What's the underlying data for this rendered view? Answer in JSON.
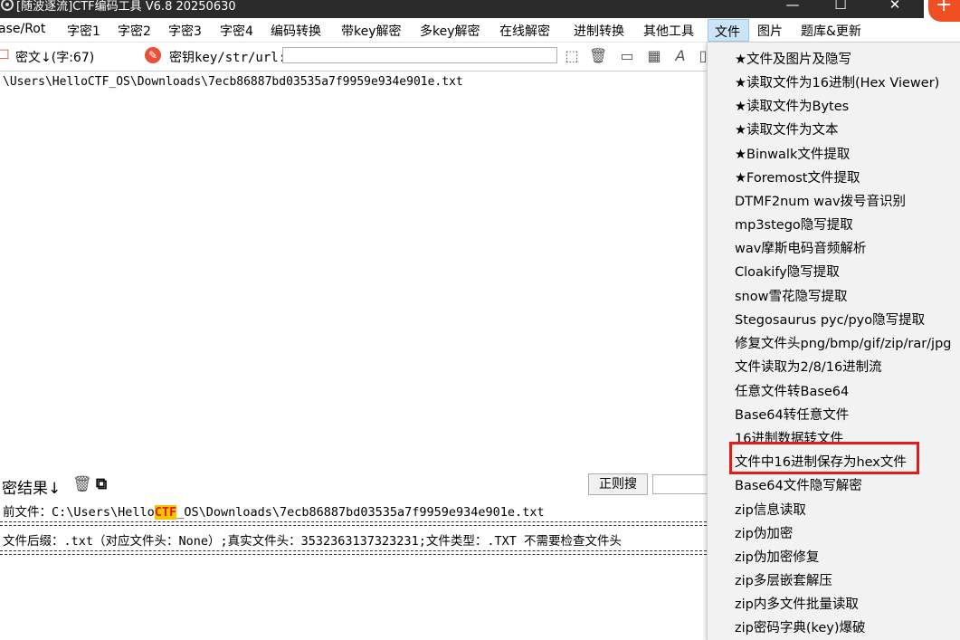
{
  "window": {
    "title": "[随波逐流]CTF编码工具 V6.8 20250630",
    "min_glyph": "—",
    "max_glyph": "☐",
    "close_glyph": "✕",
    "side_badge": "+"
  },
  "menubar": {
    "items": [
      "ase/Rot",
      "字密1",
      "字密2",
      "字密3",
      "字密4",
      "编码转换",
      "带key解密",
      "多key解密",
      "在线解密",
      "进制转换",
      "其他工具",
      "文件",
      "图片",
      "题库&更新"
    ]
  },
  "toolbar": {
    "cipher_label": "密文↓(字:67)",
    "key_label": "密钥key/str/url:",
    "key_value": "",
    "cipher_icon_glyph": "☐",
    "key_icon_glyph": "✎",
    "icons": [
      "cursor-icon",
      "trash-icon",
      "console-icon",
      "calculator-icon",
      "font-icon",
      "copy-icon"
    ],
    "icon_glyphs": [
      "⬚",
      "🗑",
      "▭",
      "▦",
      "A",
      "▯"
    ]
  },
  "cipher": {
    "text": "\\Users\\HelloCTF_OS\\Downloads\\7ecb86887bd03535a7f9959e934e901e.txt"
  },
  "result": {
    "label": "密结果↓",
    "trash_glyph": "🗑",
    "copy_glyph": "⧉",
    "regex_button": "正则搜",
    "regex_value": "",
    "line1_prefix": "前文件：C:\\Users\\Hello",
    "line1_highlight": "CTF",
    "line1_suffix": "_OS\\Downloads\\7ecb86887bd03535a7f9959e934e901e.txt",
    "line2": "文件后缀：.txt（对应文件头：None）;真实文件头：3532363137323231;文件类型：.TXT 不需要检查文件头"
  },
  "file_menu": {
    "items": [
      "★文件及图片及隐写",
      "★读取文件为16进制(Hex Viewer)",
      "★读取文件为Bytes",
      "★读取文件为文本",
      "★Binwalk文件提取",
      "★Foremost文件提取",
      "DTMF2num  wav拨号音识别",
      "mp3stego隐写提取",
      "wav摩斯电码音频解析",
      "Cloakify隐写提取",
      "snow雪花隐写提取",
      "Stegosaurus pyc/pyo隐写提取",
      "修复文件头png/bmp/gif/zip/rar/jpg",
      "文件读取为2/8/16进制流",
      "任意文件转Base64",
      "Base64转任意文件",
      "16进制数据转文件",
      "文件中16进制保存为hex文件",
      "Base64文件隐写解密",
      "zip信息读取",
      "zip伪加密",
      "zip伪加密修复",
      "zip多层嵌套解压",
      "zip内多文件批量读取",
      "zip密码字典(key)爆破"
    ],
    "highlight_color": "#e21b1b"
  }
}
